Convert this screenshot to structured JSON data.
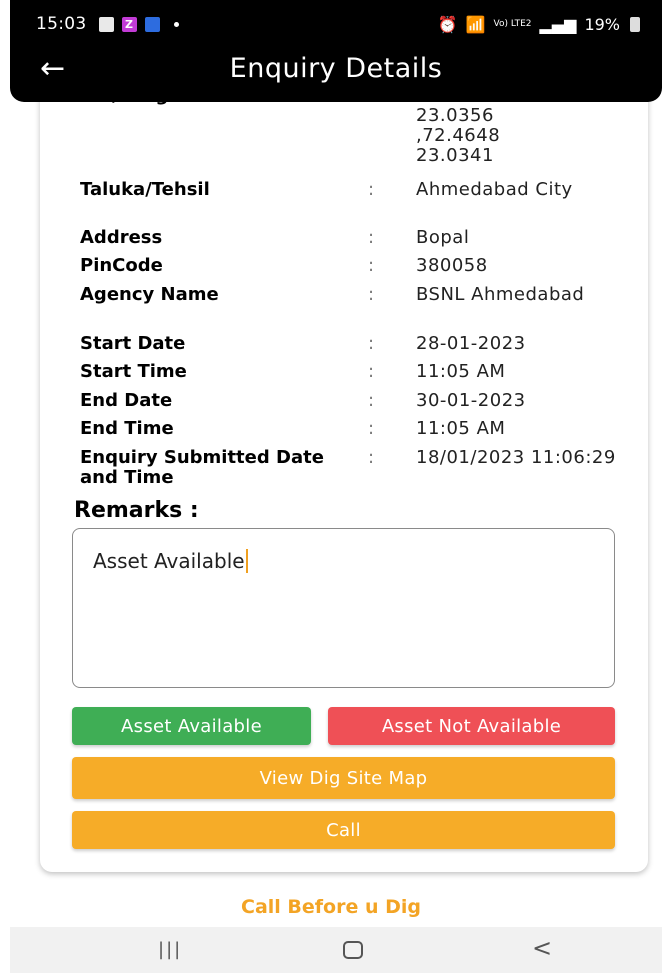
{
  "status_bar": {
    "time": "15:03",
    "z_badge": "Z",
    "signal_info": "Vo) LTE2",
    "battery": "19%"
  },
  "app_bar": {
    "title": "Enquiry Details",
    "back_icon": "←"
  },
  "details": {
    "lat_long": {
      "label": "Lat/Long of Site",
      "value_lines": [
        "72.4648",
        "23.0356",
        ",72.4648",
        "23.0341"
      ]
    },
    "rows": [
      {
        "label": "Taluka/Tehsil",
        "value": "Ahmedabad City"
      },
      {
        "label": "Address",
        "value": "Bopal"
      },
      {
        "label": "PinCode",
        "value": "380058"
      },
      {
        "label": "Agency Name",
        "value": "BSNL Ahmedabad"
      },
      {
        "label": "Start Date",
        "value": "28-01-2023"
      },
      {
        "label": "Start Time",
        "value": "11:05 AM"
      },
      {
        "label": "End Date",
        "value": "30-01-2023"
      },
      {
        "label": "End Time",
        "value": "11:05 AM"
      },
      {
        "label": "Enquiry Submitted Date and Time",
        "value": "18/01/2023 11:06:29"
      }
    ],
    "colon": ":"
  },
  "remarks": {
    "label": "Remarks :",
    "value": "Asset Available"
  },
  "buttons": {
    "asset_available": "Asset Available",
    "asset_not_available": "Asset Not Available",
    "view_map": "View Dig Site Map",
    "call": "Call"
  },
  "footer": {
    "link": "Call Before u Dig"
  },
  "colors": {
    "green": "#3fae55",
    "red": "#ef5056",
    "orange": "#f6ac28",
    "footer_orange": "#f3a425"
  }
}
